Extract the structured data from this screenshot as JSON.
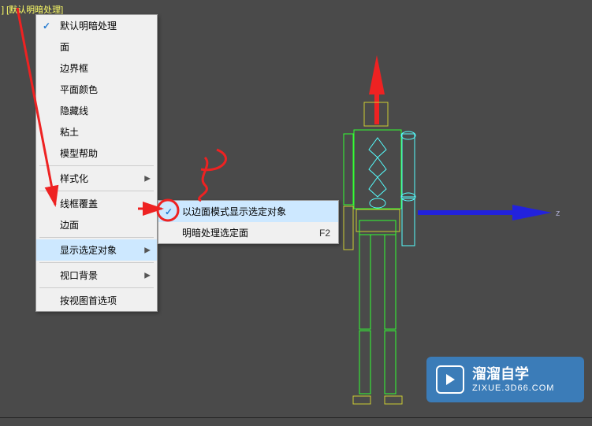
{
  "viewport_label_prefix": "] [",
  "viewport_label": "默认明暗处理",
  "viewport_label_suffix": "]",
  "menu": {
    "items": [
      {
        "label": "默认明暗处理",
        "checked": true
      },
      {
        "label": "面"
      },
      {
        "label": "边界框"
      },
      {
        "label": "平面颜色"
      },
      {
        "label": "隐藏线"
      },
      {
        "label": "粘土"
      },
      {
        "label": "模型帮助"
      },
      {
        "sep": true
      },
      {
        "label": "样式化",
        "arrow": true
      },
      {
        "sep": true
      },
      {
        "label": "线框覆盖"
      },
      {
        "label": "边面"
      },
      {
        "sep": true
      },
      {
        "label": "显示选定对象",
        "arrow": true,
        "highlighted": true
      },
      {
        "sep": true
      },
      {
        "label": "视口背景",
        "arrow": true
      },
      {
        "sep": true
      },
      {
        "label": "按视图首选项"
      }
    ]
  },
  "submenu": {
    "items": [
      {
        "label": "以边面模式显示选定对象",
        "checked": true,
        "highlighted": true
      },
      {
        "label": "明暗处理选定面",
        "shortcut": "F2"
      }
    ]
  },
  "watermark": {
    "title": "溜溜自学",
    "url": "ZIXUE.3D66.COM"
  },
  "axis_label": "z"
}
